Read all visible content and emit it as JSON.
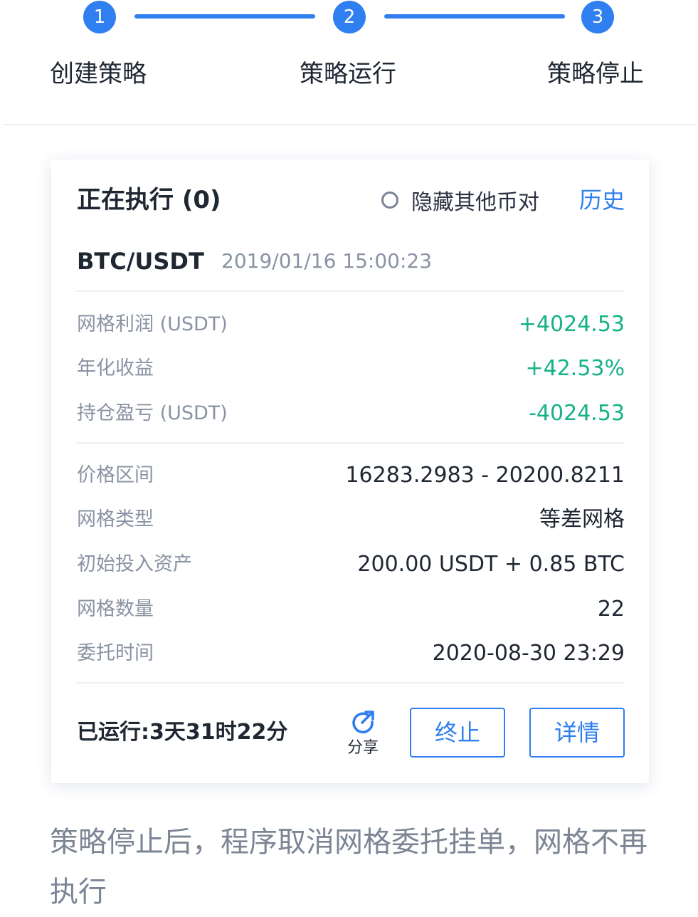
{
  "stepper": {
    "steps": [
      {
        "number": "1",
        "label": "创建策略"
      },
      {
        "number": "2",
        "label": "策略运行"
      },
      {
        "number": "3",
        "label": "策略停止"
      }
    ],
    "accent_color": "#2f7ff0"
  },
  "card": {
    "title": "正在执行 (0)",
    "hide_other_pairs_label": "隐藏其他币对",
    "history_link": "历史",
    "pair": "BTC/USDT",
    "created_time": "2019/01/16 15:00:23",
    "profit_stats": [
      {
        "label": "网格利润 (USDT)",
        "value": "+4024.53"
      },
      {
        "label": "年化收益",
        "value": "+42.53%"
      },
      {
        "label": "持仓盈亏 (USDT)",
        "value": "-4024.53"
      }
    ],
    "details": [
      {
        "label": "价格区间",
        "value": "16283.2983 - 20200.8211"
      },
      {
        "label": "网格类型",
        "value": "等差网格"
      },
      {
        "label": "初始投入资产",
        "value": "200.00 USDT + 0.85 BTC"
      },
      {
        "label": "网格数量",
        "value": "22"
      },
      {
        "label": "委托时间",
        "value": "2020-08-30 23:29"
      }
    ],
    "elapsed": "已运行:3天31时22分",
    "share_label": "分享",
    "stop_button": "终止",
    "detail_button": "详情",
    "positive_color": "#16b287"
  },
  "description": "策略停止后，程序取消网格委托挂单，网格不再执行"
}
